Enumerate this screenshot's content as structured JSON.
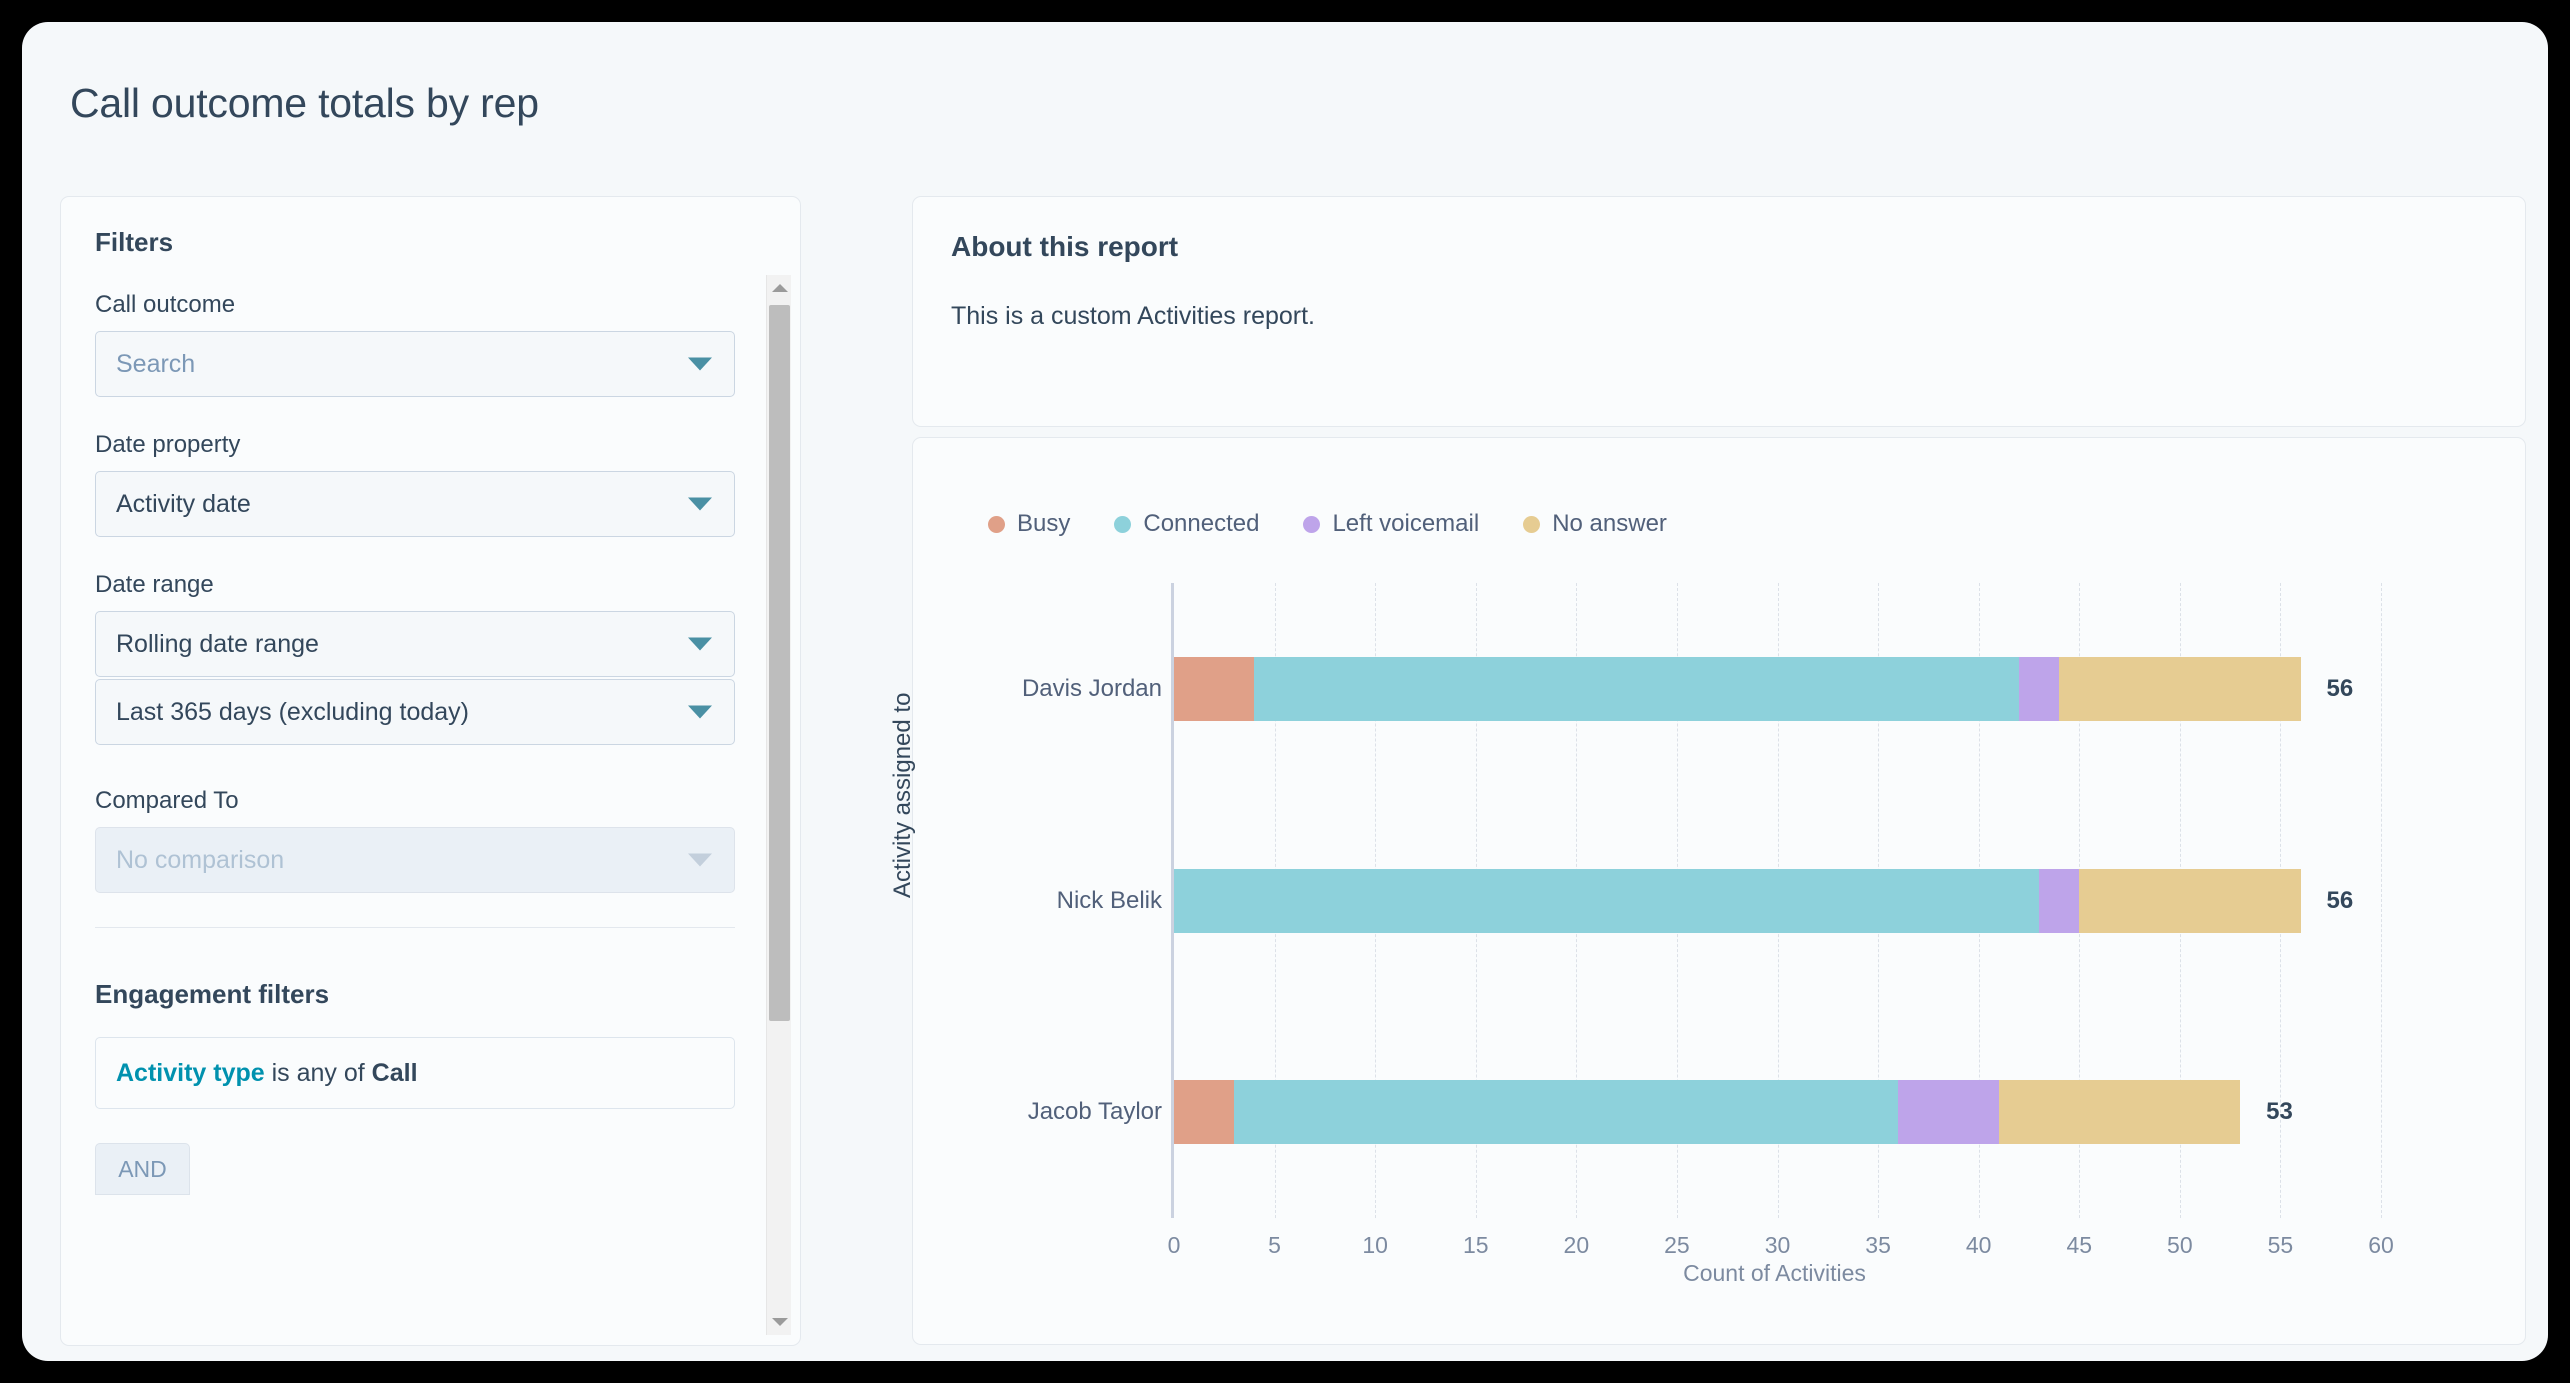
{
  "page": {
    "title": "Call outcome totals by rep"
  },
  "filters": {
    "heading": "Filters",
    "fields": [
      {
        "label": "Call outcome",
        "value": "Search",
        "state": "placeholder"
      },
      {
        "label": "Date property",
        "value": "Activity date",
        "state": "normal"
      },
      {
        "label": "Date range",
        "value": "Rolling date range",
        "state": "normal"
      },
      {
        "label": "",
        "value": "Last 365 days (excluding today)",
        "state": "normal"
      },
      {
        "label": "Compared To",
        "value": "No comparison",
        "state": "disabled"
      }
    ],
    "engagement_heading": "Engagement filters",
    "engagement_filter": {
      "property": "Activity type",
      "operator": " is any of ",
      "value": "Call"
    },
    "and_button": "AND"
  },
  "about": {
    "title": "About this report",
    "body": "This is a custom Activities report."
  },
  "chart_data": {
    "type": "bar",
    "orientation": "horizontal",
    "stacked": true,
    "title": "",
    "xlabel": "Count of Activities",
    "ylabel": "Activity assigned to",
    "xlim": [
      0,
      60
    ],
    "xticks": [
      0,
      5,
      10,
      15,
      20,
      25,
      30,
      35,
      40,
      45,
      50,
      55,
      60
    ],
    "grid": true,
    "legend_position": "top-left",
    "categories": [
      "Davis Jordan",
      "Nick Belik",
      "Jacob Taylor"
    ],
    "series": [
      {
        "name": "Busy",
        "color": "#E0A088",
        "values": [
          4,
          0,
          3
        ]
      },
      {
        "name": "Connected",
        "color": "#8DD1DB",
        "values": [
          38,
          43,
          33
        ]
      },
      {
        "name": "Left voicemail",
        "color": "#BEA4EA",
        "values": [
          2,
          2,
          5
        ]
      },
      {
        "name": "No answer",
        "color": "#E6CC92",
        "values": [
          12,
          11,
          12
        ]
      }
    ],
    "totals": [
      56,
      56,
      53
    ],
    "total_labels": [
      "56",
      "56",
      "53"
    ]
  }
}
